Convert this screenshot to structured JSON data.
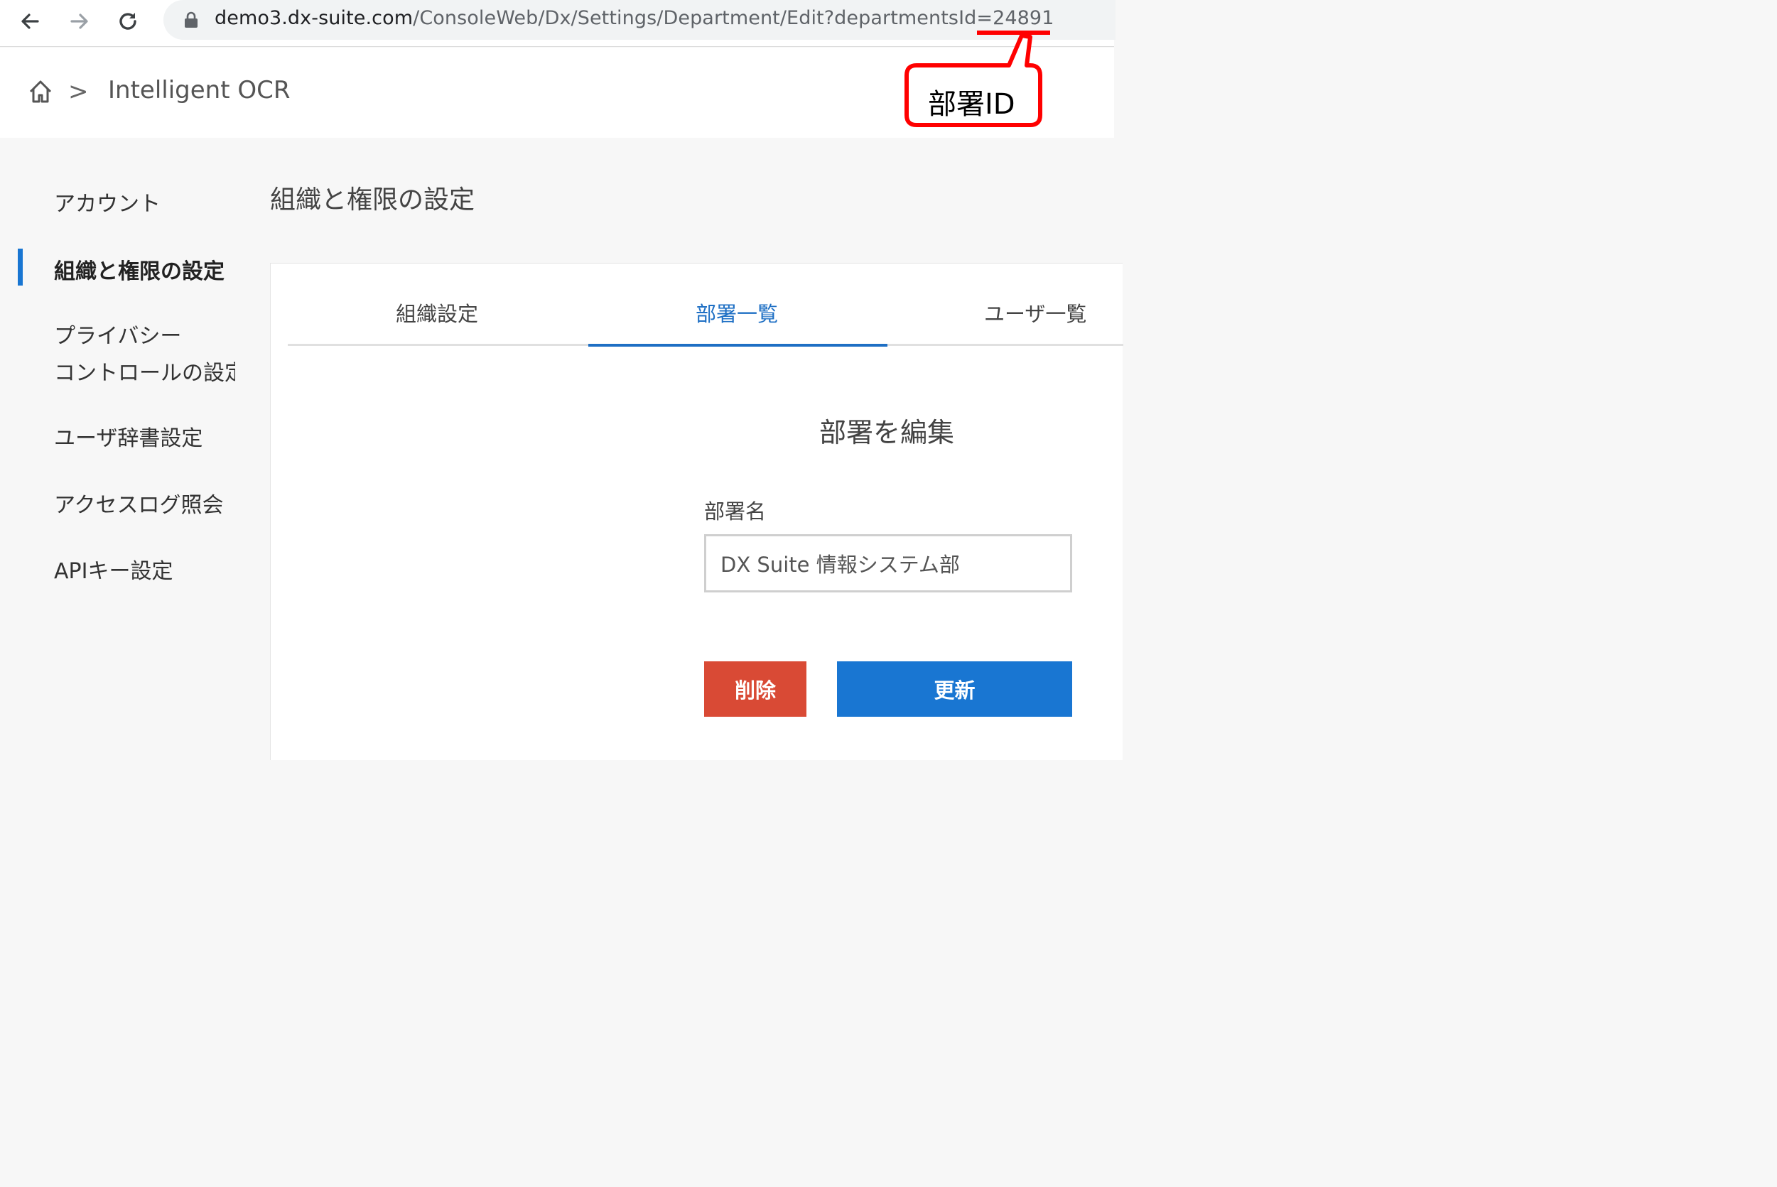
{
  "browser": {
    "url_host": "demo3.dx-suite.com",
    "url_path": "/ConsoleWeb/Dx/Settings/Department/Edit?departmentsId=24891"
  },
  "header": {
    "breadcrumb_sep": ">",
    "app_name": "Intelligent OCR"
  },
  "annotation": {
    "label": "部署ID",
    "color": "#ff0000"
  },
  "sidebar": {
    "items": [
      {
        "label": "アカウント"
      },
      {
        "label": "組織と権限の設定"
      },
      {
        "label": "プライバシー"
      },
      {
        "label": "コントロールの設定"
      },
      {
        "label": "ユーザ辞書設定"
      },
      {
        "label": "アクセスログ照会"
      },
      {
        "label": "APIキー設定"
      }
    ],
    "active_color": "#1976d2"
  },
  "main": {
    "title": "組織と権限の設定",
    "tabs": [
      {
        "label": "組織設定"
      },
      {
        "label": "部署一覧"
      },
      {
        "label": "ユーザ一覧"
      }
    ],
    "form": {
      "title": "部署を編集",
      "field_label": "部署名",
      "field_value": "DX Suite 情報システム部",
      "delete_label": "削除",
      "update_label": "更新"
    }
  },
  "colors": {
    "accent": "#1e6fc4",
    "delete": "#d94a35",
    "update": "#1976d2"
  }
}
